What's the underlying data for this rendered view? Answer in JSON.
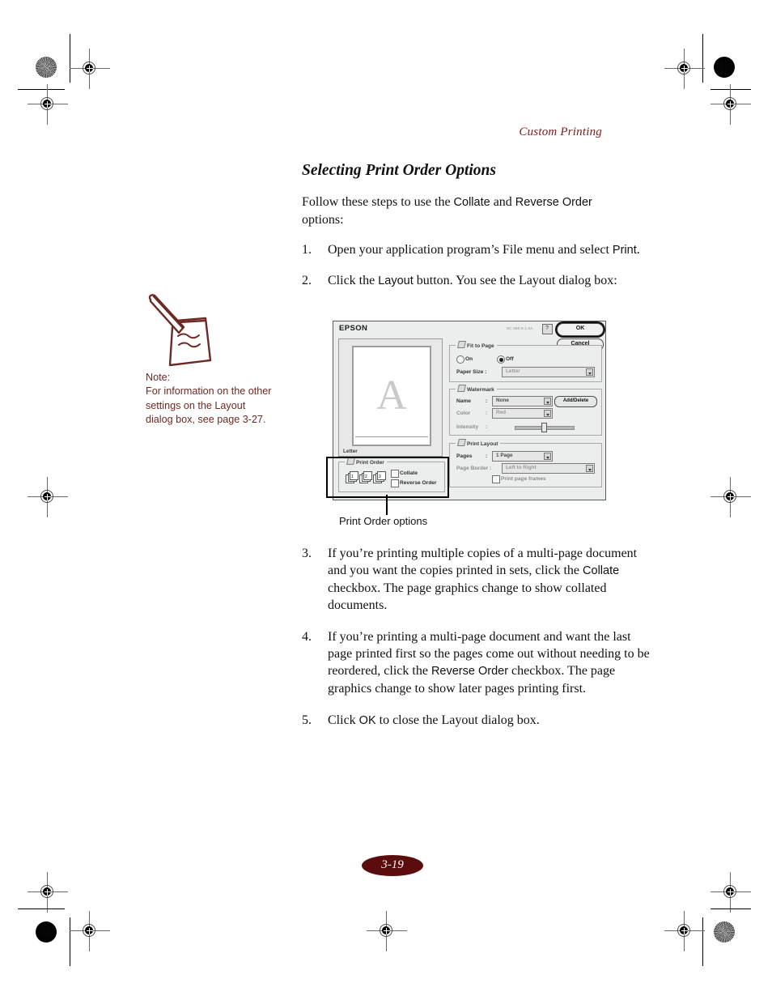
{
  "page": {
    "running_head": "Custom Printing",
    "heading": "Selecting Print Order Options",
    "intro_before": "Follow these steps to use the ",
    "intro_ui_1": "Collate",
    "intro_mid": " and ",
    "intro_ui_2": "Reverse Order",
    "intro_after": "options:",
    "page_number": "3-19"
  },
  "steps": [
    {
      "num": "1.",
      "text_a": "Open your application program’s File menu and select ",
      "ui": "Print",
      "text_b": "."
    },
    {
      "num": "2.",
      "text_a": "Click the ",
      "ui": "Layout",
      "text_b": " button. You see the Layout dialog box:"
    },
    {
      "num": "3.",
      "text_a": "If you’re printing multiple copies of a multi-page document and you want the copies printed in sets, click the ",
      "ui": "Collate",
      "text_b": " checkbox. The page graphics change to show collated documents."
    },
    {
      "num": "4.",
      "text_a": "If you’re printing a multi-page document and want the last page printed first so the pages come out without needing to be reordered, click the ",
      "ui": "Reverse Order",
      "text_b": " checkbox. The page graphics change to show later pages printing first."
    },
    {
      "num": "5.",
      "text_a": "Click ",
      "ui": "OK",
      "text_b": " to close the Layout dialog box."
    }
  ],
  "note": {
    "label": "Note:",
    "body": "For information on the other settings on the Layout dialog box, see page 3-27."
  },
  "callout": {
    "label": "Print Order options"
  },
  "dialog": {
    "title": "EPSON",
    "version": "SC 050.5.1.0A",
    "help_glyph": "?",
    "buttons": {
      "ok": "OK",
      "cancel": "Cancel"
    },
    "preview": {
      "letter_glyph": "A",
      "paper_label": "Letter"
    },
    "fit_to_page": {
      "caption": "Fit to Page",
      "radio_on": "On",
      "radio_off": "Off",
      "selected": "Off",
      "paper_size_label": "Paper Size :",
      "paper_size_value": "Letter"
    },
    "watermark": {
      "caption": "Watermark",
      "name_label": "Name",
      "name_sep": ":",
      "name_value": "None",
      "add_delete": "Add/Delete",
      "color_label": "Color",
      "color_sep": ":",
      "color_value": "Red",
      "intensity_label": "Intensity",
      "intensity_sep": ":"
    },
    "print_layout": {
      "caption": "Print Layout",
      "pages_label": "Pages",
      "pages_sep": ":",
      "pages_value": "1 Page",
      "border_label": "Page Border :",
      "border_value": "Left to Right",
      "frames_label": "Print page frames"
    },
    "print_order": {
      "caption": "Print Order",
      "collate_label": "Collate",
      "reverse_label": "Reverse Order"
    }
  },
  "colors": {
    "accent_maroon": "#7a1d1d",
    "note_text": "#6d2a24",
    "badge": "#5b0d0d",
    "dialog_bg": "#eceded"
  }
}
